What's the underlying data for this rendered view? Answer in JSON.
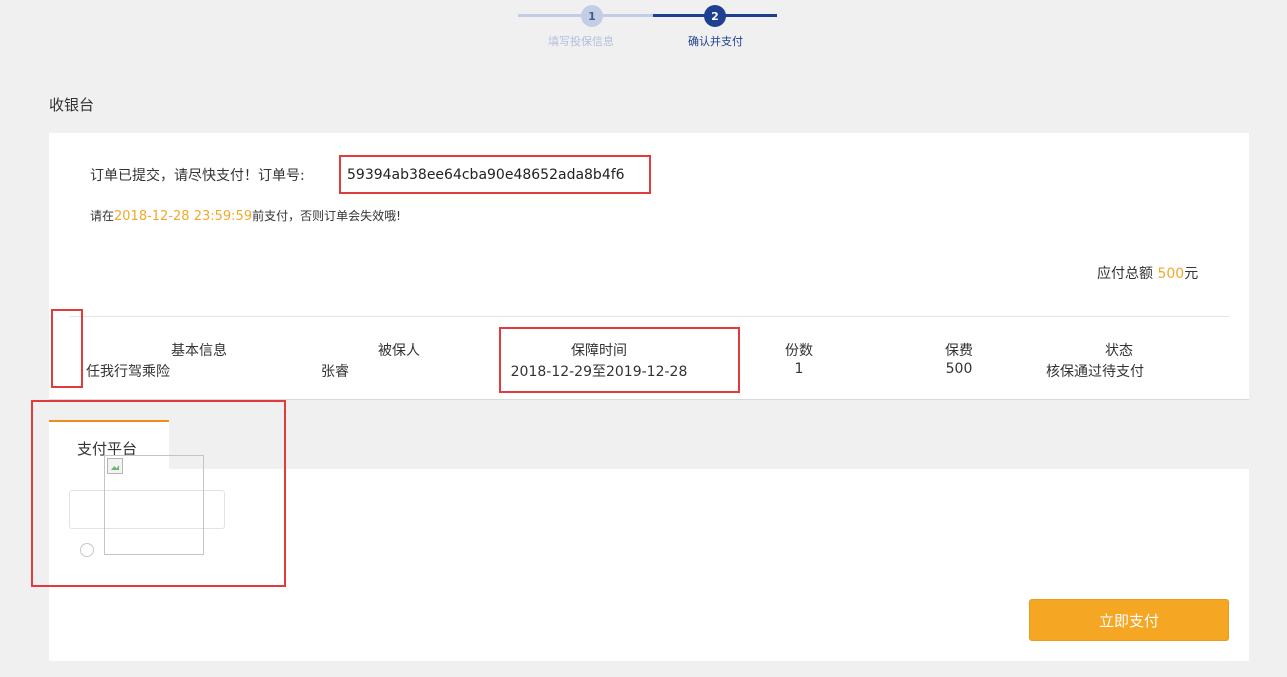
{
  "steps": [
    {
      "number": "1",
      "label": "填写投保信息",
      "state": "done"
    },
    {
      "number": "2",
      "label": "确认并支付",
      "state": "active"
    }
  ],
  "section_title": "收银台",
  "order": {
    "submitted_text": "订单已提交，请尽快支付！订单号:",
    "order_number": "59394ab38ee64cba90e48652ada8b4f6",
    "deadline_prefix": "请在",
    "deadline_time": "2018-12-28 23:59:59",
    "deadline_suffix": "前支付，否则订单会失效哦!",
    "total_label": "应付总额",
    "total_amount": "500",
    "total_unit": "元"
  },
  "table": {
    "headers": {
      "basic_info": "基本信息",
      "insured": "被保人",
      "coverage_period": "保障时间",
      "copies": "份数",
      "premium": "保费",
      "status": "状态"
    },
    "row": {
      "basic_info": "任我行驾乘险",
      "insured": "张睿",
      "coverage_period": "2018-12-29至2019-12-28",
      "copies": "1",
      "premium": "500",
      "status": "核保通过待支付"
    }
  },
  "payment": {
    "tab_label": "支付平台",
    "pay_button_label": "立即支付"
  },
  "colors": {
    "accent_orange": "#f5a623",
    "highlight_orange": "#f0a92a",
    "step_active": "#1f3f91",
    "step_done": "#c3cde6",
    "annotation_red": "#e23b3b"
  }
}
